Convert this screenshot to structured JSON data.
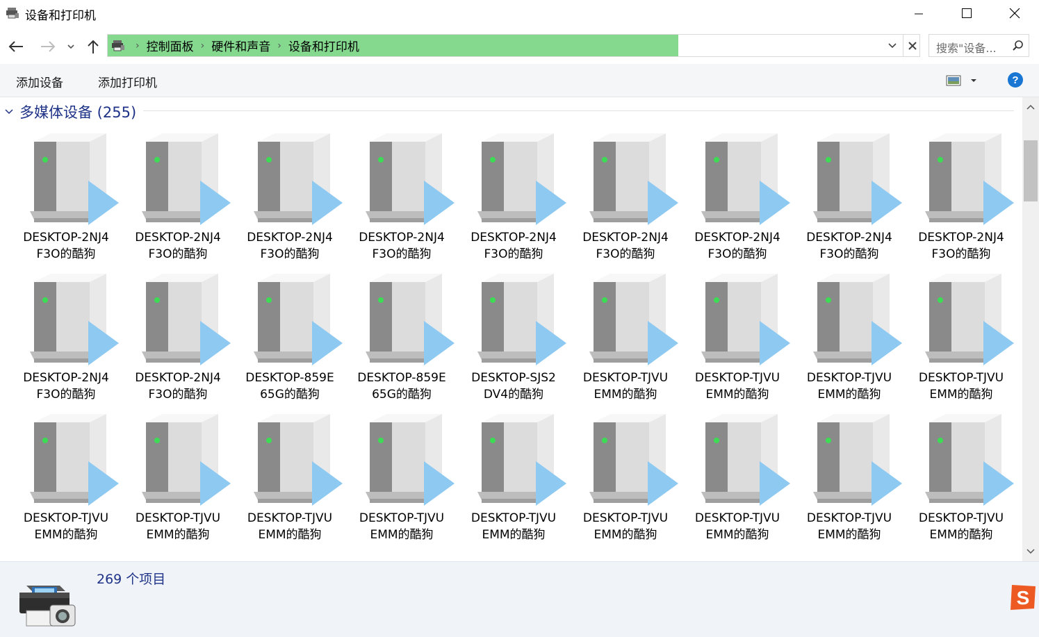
{
  "window": {
    "title": "设备和打印机",
    "colors": {
      "accent_green": "#84d98e",
      "group_title": "#1e3287",
      "help_blue": "#1976d2"
    }
  },
  "nav": {
    "breadcrumbs": [
      "控制面板",
      "硬件和声音",
      "设备和打印机"
    ],
    "search_placeholder": "搜索\"设备..."
  },
  "commands": {
    "add_device": "添加设备",
    "add_printer": "添加打印机"
  },
  "group": {
    "title": "多媒体设备 (255)"
  },
  "items": [
    {
      "line1": "DESKTOP-2NJ4",
      "line2": "F3O的酷狗"
    },
    {
      "line1": "DESKTOP-2NJ4",
      "line2": "F3O的酷狗"
    },
    {
      "line1": "DESKTOP-2NJ4",
      "line2": "F3O的酷狗"
    },
    {
      "line1": "DESKTOP-2NJ4",
      "line2": "F3O的酷狗"
    },
    {
      "line1": "DESKTOP-2NJ4",
      "line2": "F3O的酷狗"
    },
    {
      "line1": "DESKTOP-2NJ4",
      "line2": "F3O的酷狗"
    },
    {
      "line1": "DESKTOP-2NJ4",
      "line2": "F3O的酷狗"
    },
    {
      "line1": "DESKTOP-2NJ4",
      "line2": "F3O的酷狗"
    },
    {
      "line1": "DESKTOP-2NJ4",
      "line2": "F3O的酷狗"
    },
    {
      "line1": "DESKTOP-2NJ4",
      "line2": "F3O的酷狗"
    },
    {
      "line1": "DESKTOP-2NJ4",
      "line2": "F3O的酷狗"
    },
    {
      "line1": "DESKTOP-859E",
      "line2": "65G的酷狗"
    },
    {
      "line1": "DESKTOP-859E",
      "line2": "65G的酷狗"
    },
    {
      "line1": "DESKTOP-SJS2",
      "line2": "DV4的酷狗"
    },
    {
      "line1": "DESKTOP-TJVU",
      "line2": "EMM的酷狗"
    },
    {
      "line1": "DESKTOP-TJVU",
      "line2": "EMM的酷狗"
    },
    {
      "line1": "DESKTOP-TJVU",
      "line2": "EMM的酷狗"
    },
    {
      "line1": "DESKTOP-TJVU",
      "line2": "EMM的酷狗"
    },
    {
      "line1": "DESKTOP-TJVU",
      "line2": "EMM的酷狗"
    },
    {
      "line1": "DESKTOP-TJVU",
      "line2": "EMM的酷狗"
    },
    {
      "line1": "DESKTOP-TJVU",
      "line2": "EMM的酷狗"
    },
    {
      "line1": "DESKTOP-TJVU",
      "line2": "EMM的酷狗"
    },
    {
      "line1": "DESKTOP-TJVU",
      "line2": "EMM的酷狗"
    },
    {
      "line1": "DESKTOP-TJVU",
      "line2": "EMM的酷狗"
    },
    {
      "line1": "DESKTOP-TJVU",
      "line2": "EMM的酷狗"
    },
    {
      "line1": "DESKTOP-TJVU",
      "line2": "EMM的酷狗"
    },
    {
      "line1": "DESKTOP-TJVU",
      "line2": "EMM的酷狗"
    }
  ],
  "status": {
    "item_count": "269 个项目"
  },
  "icons": {
    "app": "devices-printers-icon",
    "device": "media-server-icon",
    "ime": "sogou-ime-icon"
  }
}
